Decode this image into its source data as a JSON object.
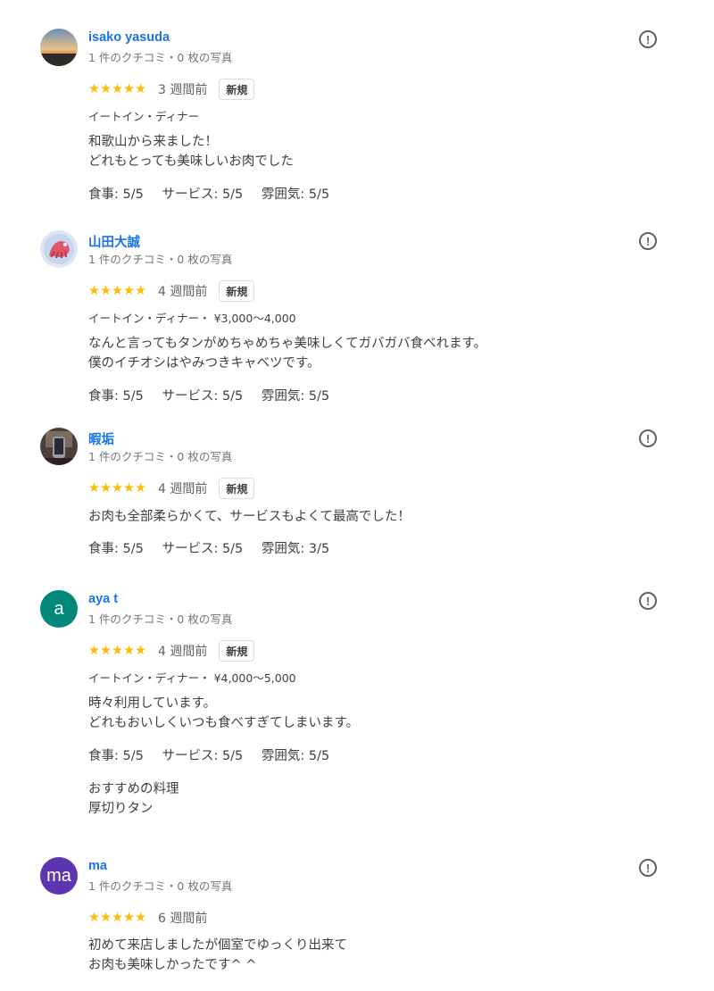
{
  "reviews": [
    {
      "name": "isako yasuda",
      "meta": "1 件のクチコミ・0 枚の写真",
      "avatar_type": "sunset-photo",
      "stars": "★★★★★",
      "time": "3 週間前",
      "badge": "新規",
      "service": "イートイン・ディナー",
      "text": "和歌山から来ました！\nどれもとっても美味しいお肉でした",
      "food": "食事: 5/5",
      "svc_score": "サービス: 5/5",
      "atmos": "雰囲気: 5/5"
    },
    {
      "name": "山田大誠",
      "meta": "1 件のクチコミ・0 枚の写真",
      "avatar_type": "illustration-photo",
      "stars": "★★★★★",
      "time": "4 週間前",
      "badge": "新規",
      "service": "イートイン・ディナー・ ¥3,000〜4,000",
      "text": "なんと言ってもタンがめちゃめちゃ美味しくてガバガバ食べれます。\n僕のイチオシはやみつきキャベツです。",
      "food": "食事: 5/5",
      "svc_score": "サービス: 5/5",
      "atmos": "雰囲気: 5/5"
    },
    {
      "name": "暇垢",
      "meta": "1 件のクチコミ・0 枚の写真",
      "avatar_type": "room-photo",
      "stars": "★★★★★",
      "time": "4 週間前",
      "badge": "新規",
      "text": "お肉も全部柔らかくて、サービスもよくて最高でした！",
      "food": "食事: 5/5",
      "svc_score": "サービス: 5/5",
      "atmos": "雰囲気: 3/5"
    },
    {
      "name": "aya t",
      "meta": "1 件のクチコミ・0 枚の写真",
      "avatar_letter": "a",
      "avatar_color": "#00897b",
      "stars": "★★★★★",
      "time": "4 週間前",
      "badge": "新規",
      "service": "イートイン・ディナー・ ¥4,000〜5,000",
      "text": "時々利用しています。\nどれもおいしくいつも食べすぎてしまいます。",
      "food": "食事: 5/5",
      "svc_score": "サービス: 5/5",
      "atmos": "雰囲気: 5/5",
      "dish_label": "おすすめの料理",
      "dish_value": "厚切りタン"
    },
    {
      "name": "ma",
      "meta": "1 件のクチコミ・0 枚の写真",
      "avatar_letter": "ma",
      "avatar_color": "#5e35b1",
      "stars": "★★★★★",
      "time": "6 週間前",
      "text": "初めて来店しましたが個室でゆっくり出来て\nお肉も美味しかったです^ ^"
    }
  ],
  "flag_glyph": "!"
}
